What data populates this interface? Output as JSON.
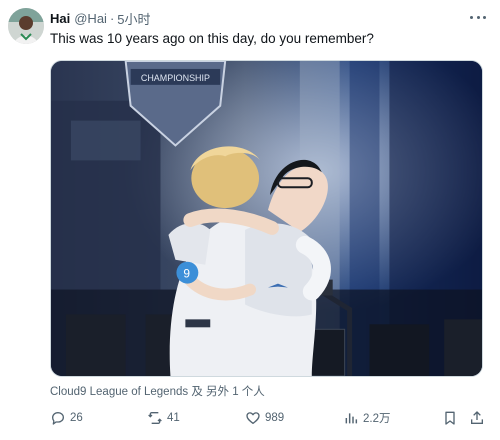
{
  "tweet": {
    "author_name": "Hai",
    "handle": "@Hai",
    "separator": "·",
    "time": "5小时",
    "text": "This was 10 years ago on this day, do you remember?",
    "tags": "Cloud9 League of Legends 及 另外 1 个人",
    "media_sign_text": "CHAMPIONSHIP"
  },
  "actions": {
    "reply_count": "26",
    "retweet_count": "41",
    "like_count": "989",
    "view_count": "2.2万"
  },
  "icons": {
    "more": "more-dots-icon",
    "reply": "reply-icon",
    "retweet": "retweet-icon",
    "like": "heart-icon",
    "views": "views-bar-chart-icon",
    "bookmark": "bookmark-icon",
    "share": "share-icon"
  },
  "colors": {
    "text_primary": "#0f1419",
    "text_secondary": "#536471",
    "border": "#cfd9de"
  }
}
